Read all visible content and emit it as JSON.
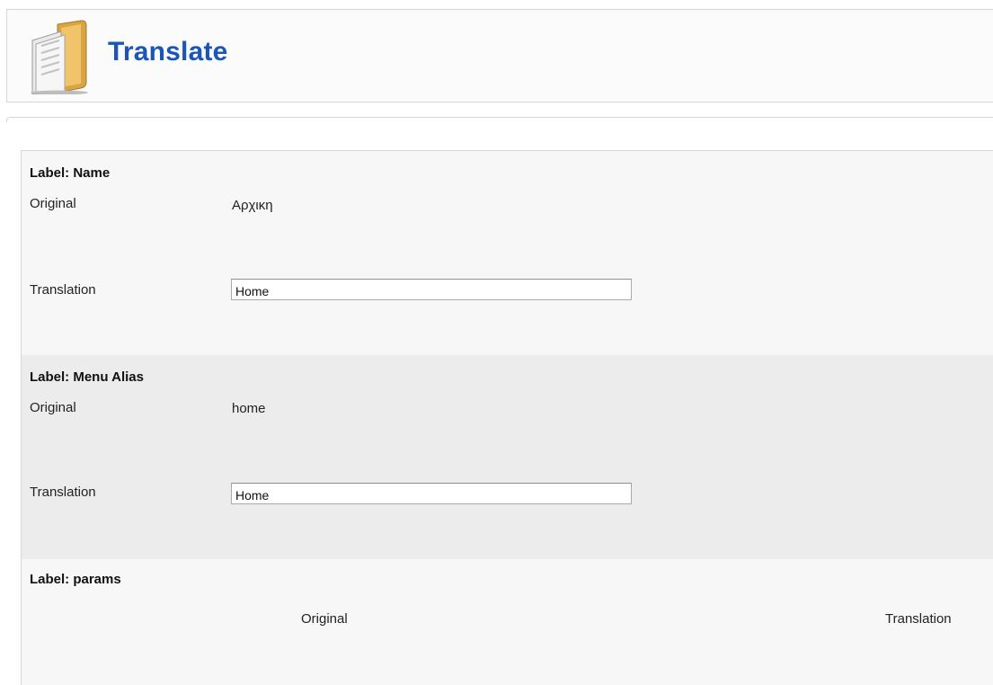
{
  "header": {
    "title": "Translate",
    "icon": "folder-document-icon"
  },
  "sections": [
    {
      "label": "Label: Name",
      "original_label": "Original",
      "original_value": "Αρχικη",
      "translation_label": "Translation",
      "translation_value": "Home"
    },
    {
      "label": "Label: Menu Alias",
      "original_label": "Original",
      "original_value": "home",
      "translation_label": "Translation",
      "translation_value": "Home"
    }
  ],
  "params": {
    "label": "Label: params",
    "original_header": "Original",
    "translation_header": "Translation"
  },
  "colors": {
    "title": "#1a56b5",
    "panel_bg": "#f7f7f7",
    "panel_alt_bg": "#ececec"
  }
}
